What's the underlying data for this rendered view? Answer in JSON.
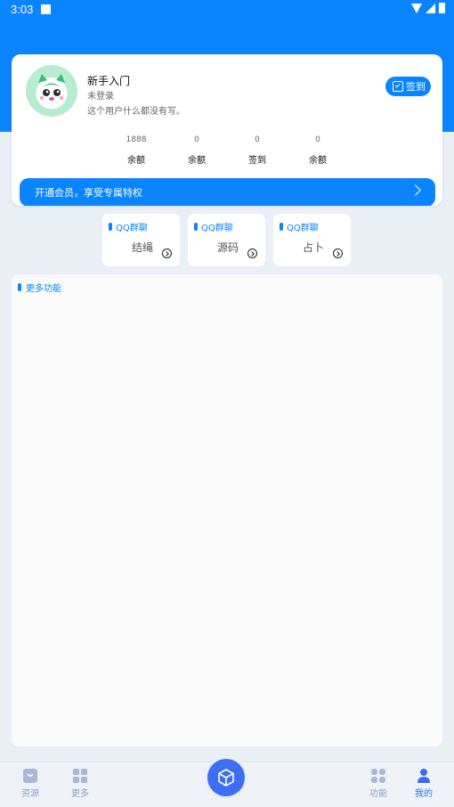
{
  "status_bar": {
    "time": "3:03"
  },
  "profile": {
    "name": "新手入门",
    "login_status": "未登录",
    "bio": "这个用户什么都没有写。",
    "signin_label": "签到"
  },
  "stats": [
    {
      "value": "1888",
      "label": "余额"
    },
    {
      "value": "0",
      "label": "余额"
    },
    {
      "value": "0",
      "label": "签到"
    },
    {
      "value": "0",
      "label": "余额"
    }
  ],
  "vip_banner": {
    "text": "开通会员，享受专属特权"
  },
  "function_cards": [
    {
      "tag": "QQ群聊",
      "name": "结绳"
    },
    {
      "tag": "QQ群聊",
      "name": "源码"
    },
    {
      "tag": "QQ群聊",
      "name": "占卜"
    }
  ],
  "more_section": {
    "title": "更多功能"
  },
  "tabbar": {
    "items": [
      {
        "label": "资源",
        "icon": "bag-icon"
      },
      {
        "label": "更多",
        "icon": "grid-icon"
      },
      {
        "label": "功能",
        "icon": "grid-icon"
      },
      {
        "label": "我的",
        "icon": "person-icon"
      }
    ],
    "center_icon": "cube-icon"
  },
  "colors": {
    "primary": "#0a84ff",
    "tab_active": "#3b6cf0",
    "tab_inactive": "#8aa0c8"
  }
}
